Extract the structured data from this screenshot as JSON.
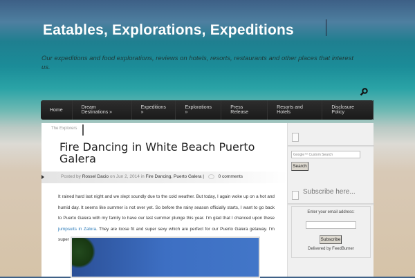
{
  "site": {
    "title": "Eatables, Explorations, Expeditions",
    "tagline": "Our expeditions and food explorations, reviews on hotels, resorts, restaurants and other places that interest us."
  },
  "nav": [
    "Home",
    "Dream Destinations »",
    "Expeditions »",
    "Explorations »",
    "Press Release",
    "Resorts and Hotels",
    "Disclosure Policy"
  ],
  "tab": "The Explorers",
  "post": {
    "title": "Fire Dancing in White Beach Puerto Galera",
    "meta": {
      "posted_by": "Posted by",
      "author": "Rossel Dacio",
      "on": "on Jun 2, 2014 in",
      "cat1": "Fire Dancing",
      "comma": ",",
      "cat2": "Puerto Galera",
      "pipe": "|",
      "comments": "0 comments"
    },
    "body_1": "It rained hard last night and we slept soundly due to the cold weather. But today, I again woke up on a hot and humid day. It seems like summer is not over yet. So before the rainy season officially starts, I want to go back to Puerto Galera with my family to have our last summer plunge this year. I'm glad that I chanced upon these ",
    "link": "jumpsuits in Zalora",
    "body_2": ". They are loose fit and super sexy which are perfect for our Puerto Galera getaway. I'm super excited!"
  },
  "sidebar": {
    "search_placeholder": "Google™ Custom Search",
    "search_button": "Search",
    "subscribe_title": "Subscribe here...",
    "email_label": "Enter your email address:",
    "subscribe_button": "Subscribe",
    "delivered": "Delivered by FeedBurner"
  }
}
